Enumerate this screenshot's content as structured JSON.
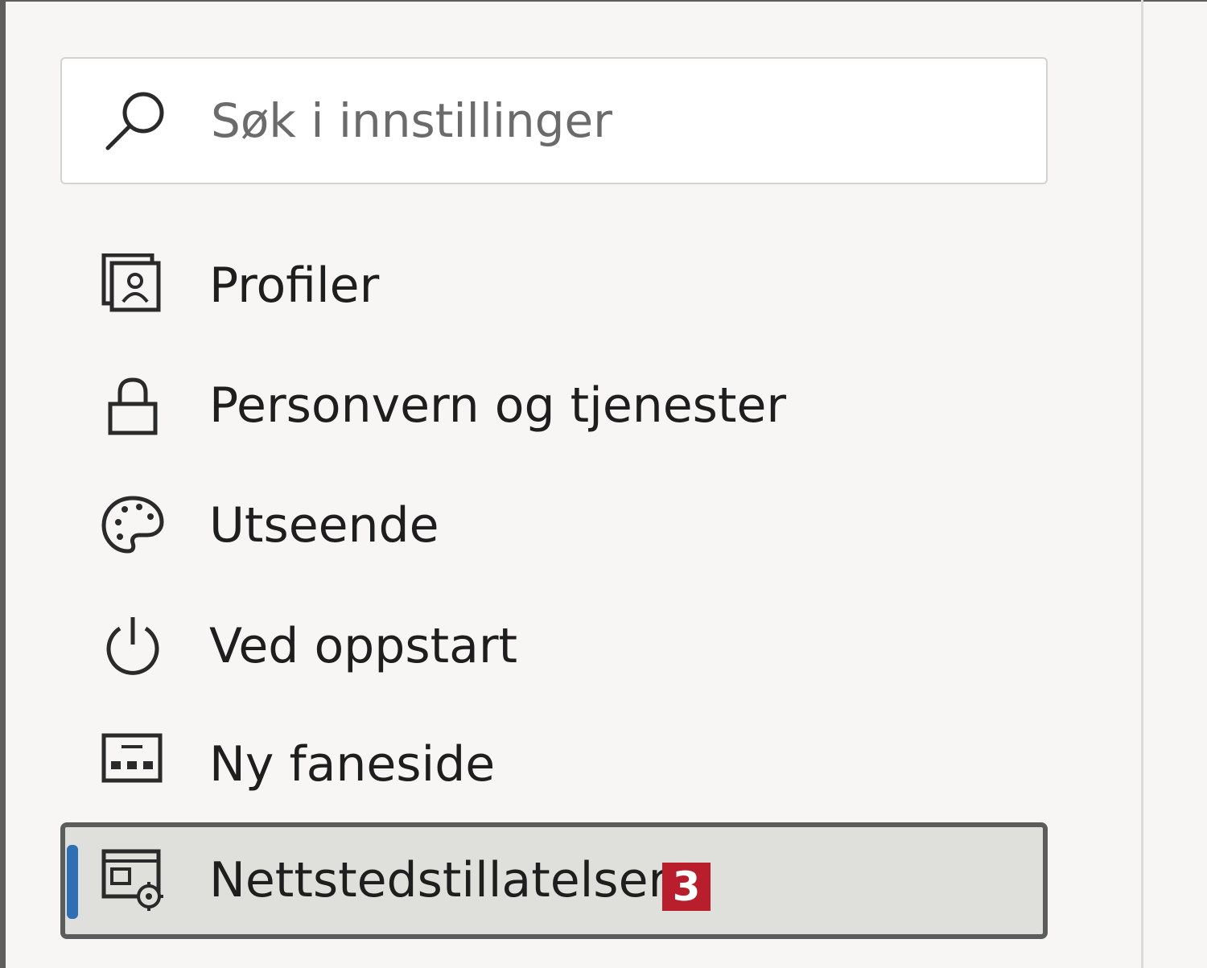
{
  "search": {
    "placeholder": "Søk i innstillinger",
    "icon": "search-icon"
  },
  "sidebar": {
    "items": [
      {
        "label": "Profiler",
        "icon": "profile-icon"
      },
      {
        "label": "Personvern og tjenester",
        "icon": "lock-icon"
      },
      {
        "label": "Utseende",
        "icon": "palette-icon"
      },
      {
        "label": "Ved oppstart",
        "icon": "power-icon"
      },
      {
        "label": "Ny faneside",
        "icon": "new-tab-page-icon"
      },
      {
        "label": "Nettstedstillatelser",
        "icon": "site-permissions-icon",
        "selected": true,
        "badge": "3"
      }
    ]
  },
  "colors": {
    "accent": "#2f6fb5",
    "badge": "#b81e2b",
    "selected_bg": "#dfdfdb",
    "background": "#f7f6f4"
  }
}
